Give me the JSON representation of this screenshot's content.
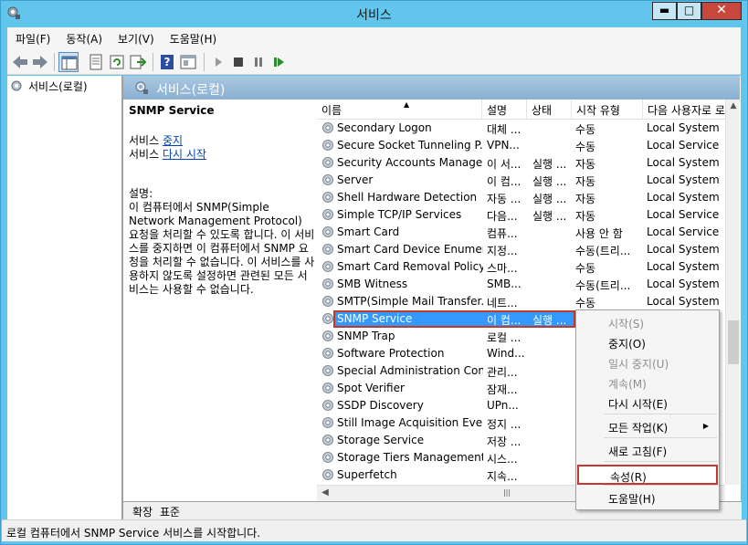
{
  "window": {
    "title": "서비스",
    "min_label": "▬",
    "max_label": "□",
    "close_label": "✕"
  },
  "menubar": [
    "파일(F)",
    "동작(A)",
    "보기(V)",
    "도움말(H)"
  ],
  "tree": {
    "root_label": "서비스(로컬)"
  },
  "pane": {
    "title": "서비스(로컬)"
  },
  "description": {
    "service_name": "SNMP Service",
    "action_prefix": "서비스 ",
    "stop_link": "중지",
    "restart_link": "다시 시작",
    "desc_label": "설명:",
    "desc_text": "이 컴퓨터에서 SNMP(Simple Network Management Protocol) 요청을 처리할 수 있도록 합니다. 이 서비스를 중지하면 이 컴퓨터에서 SNMP 요청을 처리할 수 없습니다. 이 서비스를 사용하지 않도록 설정하면 관련된 모든 서비스는 사용할 수 없습니다."
  },
  "columns": {
    "name": "이름",
    "desc": "설명",
    "status": "상태",
    "start": "시작 유형",
    "logon": "다음 사용자로 로"
  },
  "rows": [
    {
      "name": "Secondary Logon",
      "desc": "대체 ...",
      "status": "",
      "start": "수동",
      "logon": "Local System"
    },
    {
      "name": "Secure Socket Tunneling P...",
      "desc": "VPN...",
      "status": "",
      "start": "수동",
      "logon": "Local Service"
    },
    {
      "name": "Security Accounts Manager",
      "desc": "이 서...",
      "status": "실행 ...",
      "start": "자동",
      "logon": "Local System"
    },
    {
      "name": "Server",
      "desc": "이 컴...",
      "status": "실행 ...",
      "start": "자동",
      "logon": "Local System"
    },
    {
      "name": "Shell Hardware Detection",
      "desc": "자동 ...",
      "status": "실행 ...",
      "start": "자동",
      "logon": "Local System"
    },
    {
      "name": "Simple TCP/IP Services",
      "desc": "다음...",
      "status": "실행 ...",
      "start": "자동",
      "logon": "Local Service"
    },
    {
      "name": "Smart Card",
      "desc": "컴퓨...",
      "status": "",
      "start": "사용 안 함",
      "logon": "Local Service"
    },
    {
      "name": "Smart Card Device Enumer...",
      "desc": "지정...",
      "status": "",
      "start": "수동(트리...",
      "logon": "Local System"
    },
    {
      "name": "Smart Card Removal Policy",
      "desc": "스마...",
      "status": "",
      "start": "수동",
      "logon": "Local System"
    },
    {
      "name": "SMB Witness",
      "desc": "SMB...",
      "status": "",
      "start": "수동(트리...",
      "logon": "Local System"
    },
    {
      "name": "SMTP(Simple Mail Transfer...",
      "desc": "네트...",
      "status": "",
      "start": "수동",
      "logon": "Local System"
    },
    {
      "name": "SNMP Service",
      "desc": "이 컴...",
      "status": "실행 ...",
      "start": "",
      "logon": ""
    },
    {
      "name": "SNMP Trap",
      "desc": "로컬 ...",
      "status": "",
      "start": "",
      "logon": ""
    },
    {
      "name": "Software Protection",
      "desc": "Wind...",
      "status": "",
      "start": "",
      "logon": ""
    },
    {
      "name": "Special Administration Con...",
      "desc": "관리...",
      "status": "",
      "start": "",
      "logon": ""
    },
    {
      "name": "Spot Verifier",
      "desc": "잠재...",
      "status": "",
      "start": "",
      "logon": ""
    },
    {
      "name": "SSDP Discovery",
      "desc": "UPn...",
      "status": "",
      "start": "",
      "logon": ""
    },
    {
      "name": "Still Image Acquisition Eve...",
      "desc": "정지 ...",
      "status": "",
      "start": "",
      "logon": ""
    },
    {
      "name": "Storage Service",
      "desc": "저장 ...",
      "status": "",
      "start": "",
      "logon": ""
    },
    {
      "name": "Storage Tiers Management",
      "desc": "시스...",
      "status": "",
      "start": "",
      "logon": ""
    },
    {
      "name": "Superfetch",
      "desc": "지속...",
      "status": "",
      "start": "",
      "logon": ""
    }
  ],
  "selected_row": 11,
  "context_menu": [
    {
      "label": "시작(S)",
      "disabled": true
    },
    {
      "label": "중지(O)",
      "disabled": false
    },
    {
      "label": "일시 중지(U)",
      "disabled": true
    },
    {
      "label": "계속(M)",
      "disabled": true
    },
    {
      "label": "다시 시작(E)",
      "disabled": false
    },
    {
      "label": "모든 작업(K)",
      "disabled": false,
      "submenu": true
    },
    {
      "label": "새로 고침(F)",
      "disabled": false
    },
    {
      "label": "속성(R)",
      "disabled": false,
      "highlighted": true
    },
    {
      "label": "도움말(H)",
      "disabled": false
    }
  ],
  "tabs": [
    "확장",
    "표준"
  ],
  "statusbar": {
    "text": "로컬 컴퓨터에서 SNMP Service 서비스를 시작합니다."
  },
  "colors": {
    "title_bg": "#61c5ec",
    "selection": "#3399ff",
    "highlight_border": "#c0392b"
  }
}
